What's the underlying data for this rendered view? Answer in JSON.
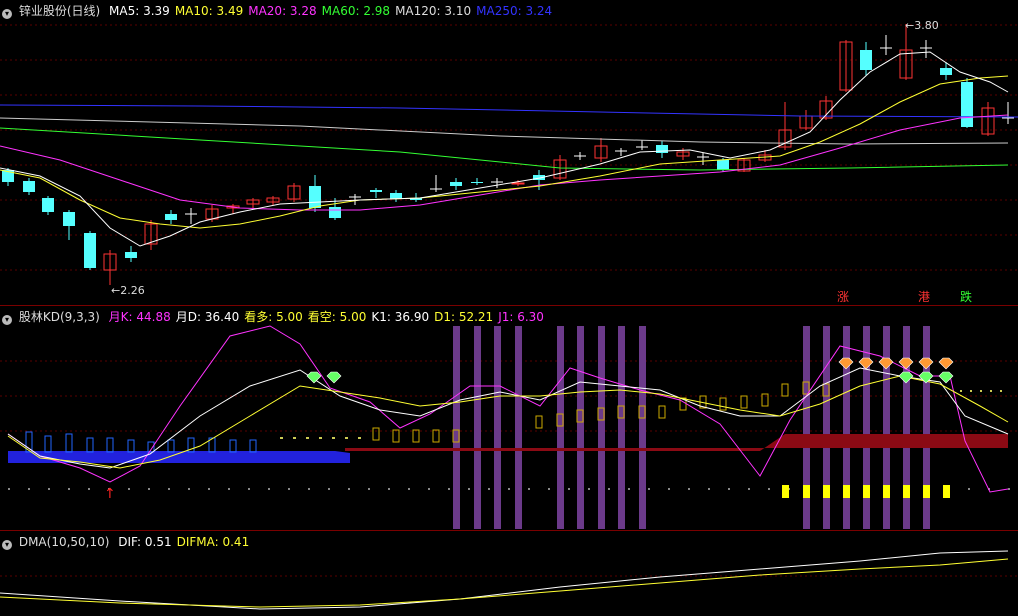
{
  "main": {
    "stock_name": "锌业股份(日线)",
    "ma": [
      {
        "label": "MA5: 3.39",
        "color": "#ffffff"
      },
      {
        "label": "MA10: 3.49",
        "color": "#ffff33"
      },
      {
        "label": "MA20: 3.28",
        "color": "#ff33ff"
      },
      {
        "label": "MA60: 2.98",
        "color": "#33ff33"
      },
      {
        "label": "MA120: 3.10",
        "color": "#dddddd"
      },
      {
        "label": "MA250: 3.24",
        "color": "#3333ff"
      }
    ],
    "high_label": "3.80",
    "low_label": "2.26",
    "flags": [
      {
        "text": "涨",
        "color": "#ff3333"
      },
      {
        "text": "港",
        "color": "#ff3333"
      },
      {
        "text": "跌",
        "color": "#33ff33"
      }
    ]
  },
  "kd": {
    "name": "股林KD(9,3,3)",
    "items": [
      {
        "label": "月K: 44.88",
        "color": "#ff33ff"
      },
      {
        "label": "月D: 36.40",
        "color": "#ffffff"
      },
      {
        "label": "看多: 5.00",
        "color": "#ffff33"
      },
      {
        "label": "看空: 5.00",
        "color": "#ffff33"
      },
      {
        "label": "K1: 36.90",
        "color": "#ffffff"
      },
      {
        "label": "D1: 52.21",
        "color": "#ffff33"
      },
      {
        "label": "J1: 6.30",
        "color": "#ff33ff"
      }
    ]
  },
  "dma": {
    "name": "DMA(10,50,10)",
    "items": [
      {
        "label": "DIF: 0.51",
        "color": "#ffffff"
      },
      {
        "label": "DIFMA: 0.41",
        "color": "#ffff33"
      }
    ]
  },
  "colors": {
    "up": "#ff3333",
    "down": "#55ffff",
    "grid": "#7a0000"
  }
}
